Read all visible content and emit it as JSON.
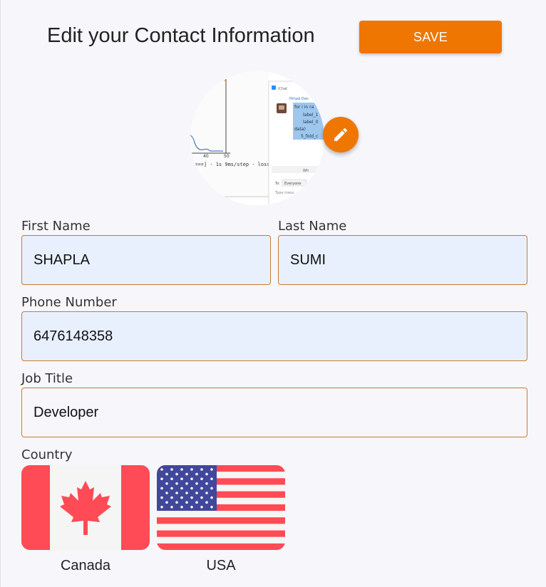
{
  "header": {
    "title": "Edit your Contact Information",
    "save_label": "SAVE"
  },
  "colors": {
    "accent": "#ef7600",
    "input_border": "#c77d2e",
    "autofill_bg": "#e8f0fe"
  },
  "avatar": {
    "edit_icon": "pencil-icon",
    "screenshot_text": {
      "tick_40": "40",
      "tick_50": "50",
      "console_line": "====] - 1s 9ms/step - loss:",
      "app_name": "iChat",
      "sender": "Hrnad Dan",
      "code_lines": [
        "for i in ra",
        "label_1",
        "label_0",
        "data)",
        "5_fold_c"
      ],
      "to_label": "To:",
      "to_value": "Everyone",
      "message_placeholder": "Type mess",
      "hint": "Wh"
    }
  },
  "form": {
    "first_name": {
      "label": "First Name",
      "value": "SHAPLA"
    },
    "last_name": {
      "label": "Last Name",
      "value": "SUMI"
    },
    "phone": {
      "label": "Phone Number",
      "value": "6476148358"
    },
    "job_title": {
      "label": "Job Title",
      "value": "Developer"
    },
    "country": {
      "label": "Country",
      "options": [
        {
          "label": "Canada",
          "flag": "canada-flag"
        },
        {
          "label": "USA",
          "flag": "usa-flag"
        }
      ]
    }
  }
}
